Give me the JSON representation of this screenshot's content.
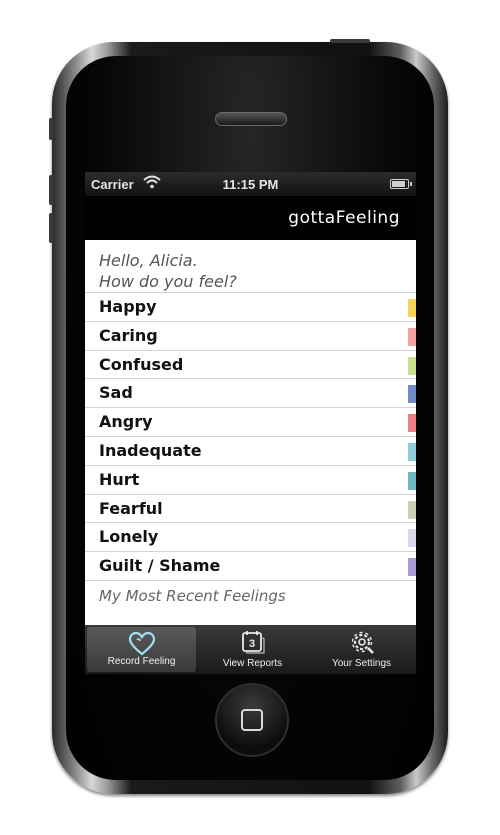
{
  "status_bar": {
    "carrier": "Carrier",
    "time": "11:15 PM"
  },
  "nav": {
    "title": "gottaFeeling"
  },
  "greeting": {
    "line1": "Hello, Alicia.",
    "line2": "How do you feel?"
  },
  "feelings": [
    {
      "label": "Happy",
      "color": "#f3d35a"
    },
    {
      "label": "Caring",
      "color": "#f2a3a0"
    },
    {
      "label": "Confused",
      "color": "#c7e08e"
    },
    {
      "label": "Sad",
      "color": "#6f8ec6"
    },
    {
      "label": "Angry",
      "color": "#ec7f86"
    },
    {
      "label": "Inadequate",
      "color": "#8ccfd8"
    },
    {
      "label": "Hurt",
      "color": "#6fb7c2"
    },
    {
      "label": "Fearful",
      "color": "#c9d3b4"
    },
    {
      "label": "Lonely",
      "color": "#ddd6ea"
    },
    {
      "label": "Guilt / Shame",
      "color": "#a99ad3"
    }
  ],
  "recent_label": "My Most Recent Feelings",
  "tabs": [
    {
      "label": "Record Feeling",
      "icon": "heart-icon",
      "active": true
    },
    {
      "label": "View Reports",
      "icon": "calendar-icon",
      "calendar_number": "3"
    },
    {
      "label": "Your Settings",
      "icon": "gear-icon"
    }
  ]
}
